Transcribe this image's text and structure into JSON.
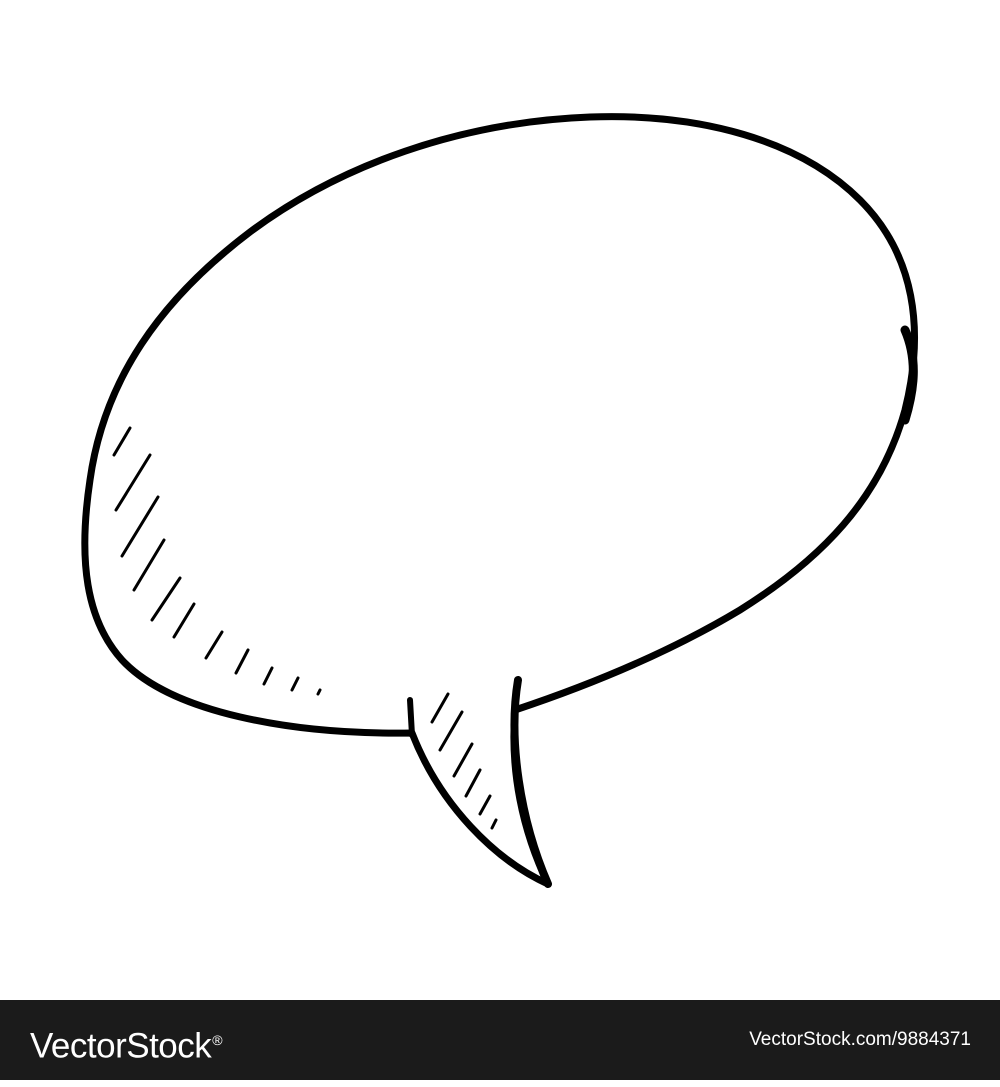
{
  "illustration": {
    "subject": "speech-bubble-icon",
    "stroke_color": "#000000",
    "fill_color": "#ffffff",
    "background": "#ffffff"
  },
  "footer": {
    "background": "#1b1b1b",
    "text_color": "#ffffff",
    "brand": "VectorStock",
    "brand_mark": "®",
    "image_ref": "VectorStock.com/9884371"
  }
}
